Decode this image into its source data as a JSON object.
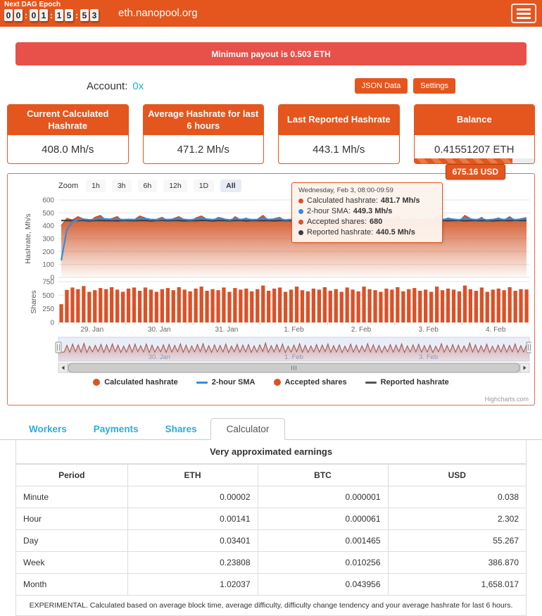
{
  "header": {
    "next_dag_label": "Next DAG Epoch",
    "countdown": "00:01:15:53",
    "title": "eth.nanopool.org"
  },
  "banner": {
    "text": "Minimum payout is 0.503 ETH"
  },
  "account": {
    "label": "Account:",
    "address": "0x",
    "json_button": "JSON Data",
    "settings_button": "Settings"
  },
  "stats": {
    "cards": [
      {
        "title": "Current Calculated Hashrate",
        "value": "408.0 Mh/s"
      },
      {
        "title": "Average Hashrate for last 6 hours",
        "value": "471.2 Mh/s"
      },
      {
        "title": "Last Reported Hashrate",
        "value": "443.1 Mh/s"
      },
      {
        "title": "Balance",
        "value": "0.41551207 ETH",
        "progress_pct": 82,
        "usd_tooltip": "675.16 USD"
      }
    ]
  },
  "chart": {
    "zoom_label": "Zoom",
    "zoom_buttons": [
      "1h",
      "3h",
      "6h",
      "12h",
      "1D",
      "All"
    ],
    "zoom_active": "All",
    "tooltip": {
      "title": "Wednesday, Feb 3, 08:00-09:59",
      "rows": [
        {
          "label": "Calculated hashrate:",
          "value": "481.7 Mh/s",
          "color": "#dc5126"
        },
        {
          "label": "2-hour SMA:",
          "value": "449.3 Mh/s",
          "color": "#2e8de5"
        },
        {
          "label": "Accepted shares:",
          "value": "680",
          "color": "#dc5126"
        },
        {
          "label": "Reported hashrate:",
          "value": "440.5 Mh/s",
          "color": "#3a3a3a"
        }
      ]
    },
    "legend": [
      {
        "label": "Calculated hashrate",
        "marker": "circle",
        "color": "#dc5126"
      },
      {
        "label": "2-hour SMA",
        "marker": "line",
        "color": "#2e8de5"
      },
      {
        "label": "Accepted shares",
        "marker": "circle",
        "color": "#dc5126"
      },
      {
        "label": "Reported hashrate",
        "marker": "line",
        "color": "#555555"
      }
    ],
    "credits": "Highcharts.com"
  },
  "chart_data": {
    "type": "mixed",
    "x_labels": [
      "29. Jan",
      "30. Jan",
      "31. Jan",
      "1. Feb",
      "2. Feb",
      "3. Feb",
      "4. Feb"
    ],
    "y_axis_hashrate": {
      "label": "Hashrate, Mh/s",
      "ticks": [
        0,
        100,
        200,
        300,
        400,
        500,
        600
      ],
      "max": 600
    },
    "y_axis_shares": {
      "label": "Shares",
      "ticks": [
        0,
        250,
        500,
        750
      ],
      "max": 750
    },
    "navigator_labels": [
      "30. Jan",
      "1. Feb",
      "3. Feb"
    ],
    "series": [
      {
        "name": "Calculated hashrate",
        "type": "area",
        "color": "#cf4d1c",
        "values": [
          402,
          458,
          446,
          471,
          452,
          433,
          466,
          481,
          441,
          456,
          472,
          436,
          451,
          446,
          476,
          461,
          431,
          451,
          466,
          441,
          456,
          471,
          446,
          431,
          461,
          476,
          451,
          441,
          466,
          456,
          431,
          471,
          446,
          461,
          436,
          451,
          481,
          441,
          456,
          466,
          431,
          451,
          471,
          446,
          436,
          461,
          451,
          476,
          441,
          456,
          431,
          466,
          451,
          441,
          471,
          456,
          446,
          431,
          461,
          451,
          476,
          436,
          456,
          466,
          441,
          451,
          431,
          471,
          446,
          461,
          451,
          436,
          481,
          456,
          441,
          466,
          431,
          451,
          461,
          446,
          471,
          441,
          456,
          463
        ]
      },
      {
        "name": "2-hour SMA",
        "type": "line",
        "color": "#2e8de5",
        "values": [
          132,
          368,
          432,
          446,
          451,
          446,
          449,
          456,
          453,
          449,
          451,
          447,
          449,
          448,
          453,
          456,
          449,
          447,
          451,
          448,
          450,
          453,
          449,
          445,
          451,
          456,
          451,
          447,
          453,
          451,
          445,
          453,
          449,
          453,
          447,
          449,
          457,
          449,
          451,
          453,
          445,
          449,
          454,
          449,
          445,
          451,
          450,
          455,
          447,
          451,
          445,
          453,
          449,
          446,
          454,
          451,
          448,
          445,
          451,
          449,
          455,
          446,
          451,
          453,
          447,
          450,
          445,
          454,
          448,
          452,
          450,
          446,
          457,
          451,
          447,
          453,
          445,
          449,
          452,
          448,
          454,
          447,
          450,
          452
        ]
      },
      {
        "name": "Accepted shares",
        "type": "column",
        "color": "#dc5126",
        "values": [
          335,
          598,
          642,
          612,
          668,
          562,
          592,
          632,
          612,
          648,
          602,
          562,
          622,
          642,
          582,
          642,
          602,
          562,
          612,
          632,
          592,
          648,
          602,
          572,
          622,
          658,
          582,
          612,
          592,
          642,
          562,
          632,
          602,
          622,
          572,
          612,
          678,
          582,
          622,
          642,
          562,
          602,
          658,
          592,
          572,
          622,
          602,
          648,
          582,
          612,
          562,
          642,
          602,
          572,
          658,
          612,
          592,
          562,
          622,
          602,
          648,
          572,
          612,
          632,
          582,
          602,
          562,
          658,
          592,
          622,
          602,
          572,
          678,
          612,
          582,
          642,
          562,
          602,
          622,
          592,
          648,
          582,
          612,
          605
        ]
      },
      {
        "name": "Reported hashrate",
        "type": "line",
        "color": "#3a3a3a",
        "values": [
          440,
          441,
          439,
          440,
          442,
          438,
          440,
          441,
          439,
          440,
          438,
          442,
          440,
          439,
          441,
          440,
          438,
          440,
          442,
          439,
          440,
          441,
          438,
          440,
          439,
          442,
          440,
          438,
          441,
          440,
          439,
          440,
          442,
          438,
          440,
          441,
          439,
          440,
          438,
          441,
          440,
          439,
          442,
          440,
          438,
          440,
          441,
          439,
          440,
          438,
          442,
          440,
          439,
          441,
          440,
          438,
          440,
          442,
          439,
          440,
          441,
          438,
          440,
          439,
          442,
          440,
          438,
          441,
          440,
          439,
          440,
          442,
          438,
          440,
          441,
          439,
          440,
          438,
          441,
          440,
          439,
          442,
          440,
          440
        ]
      }
    ]
  },
  "tabs": {
    "items": [
      "Workers",
      "Payments",
      "Shares",
      "Calculator"
    ],
    "active": "Calculator"
  },
  "earnings": {
    "title": "Very approximated earnings",
    "columns": [
      "Period",
      "ETH",
      "BTC",
      "USD"
    ],
    "rows": [
      {
        "period": "Minute",
        "eth": "0.00002",
        "btc": "0.000001",
        "usd": "0.038"
      },
      {
        "period": "Hour",
        "eth": "0.00141",
        "btc": "0.000061",
        "usd": "2.302"
      },
      {
        "period": "Day",
        "eth": "0.03401",
        "btc": "0.001465",
        "usd": "55.267"
      },
      {
        "period": "Week",
        "eth": "0.23808",
        "btc": "0.010256",
        "usd": "386.870"
      },
      {
        "period": "Month",
        "eth": "1.02037",
        "btc": "0.043956",
        "usd": "1,658.017"
      }
    ],
    "note": "EXPERIMENTAL. Calculated based on average block time, average difficulty, difficulty change tendency and your average hashrate for last 6 hours."
  }
}
